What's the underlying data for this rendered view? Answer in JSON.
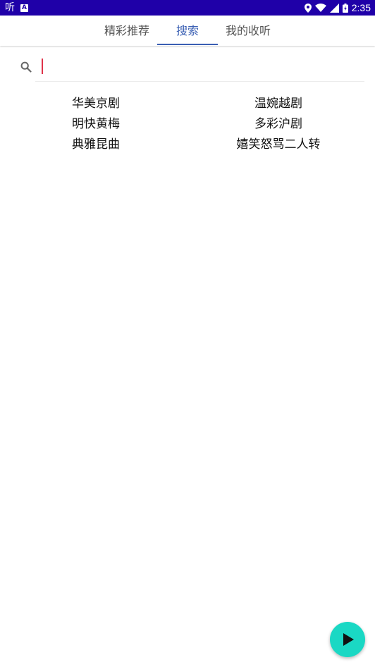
{
  "status_bar": {
    "app_glyph": "听",
    "badge": "A",
    "time": "2:35"
  },
  "tabs": [
    {
      "label": "精彩推荐",
      "active": false
    },
    {
      "label": "搜索",
      "active": true
    },
    {
      "label": "我的收听",
      "active": false
    }
  ],
  "search": {
    "icon": "search-icon",
    "value": "",
    "placeholder": ""
  },
  "genres": [
    "华美京剧",
    "温婉越剧",
    "明快黄梅",
    "多彩沪剧",
    "典雅昆曲",
    "嬉笑怒骂二人转"
  ],
  "fab": {
    "icon": "play-icon"
  },
  "colors": {
    "status_bar": "#1f00a8",
    "accent": "#3a5fb3",
    "caret": "#e0334a",
    "fab": "#1ad8c4"
  }
}
